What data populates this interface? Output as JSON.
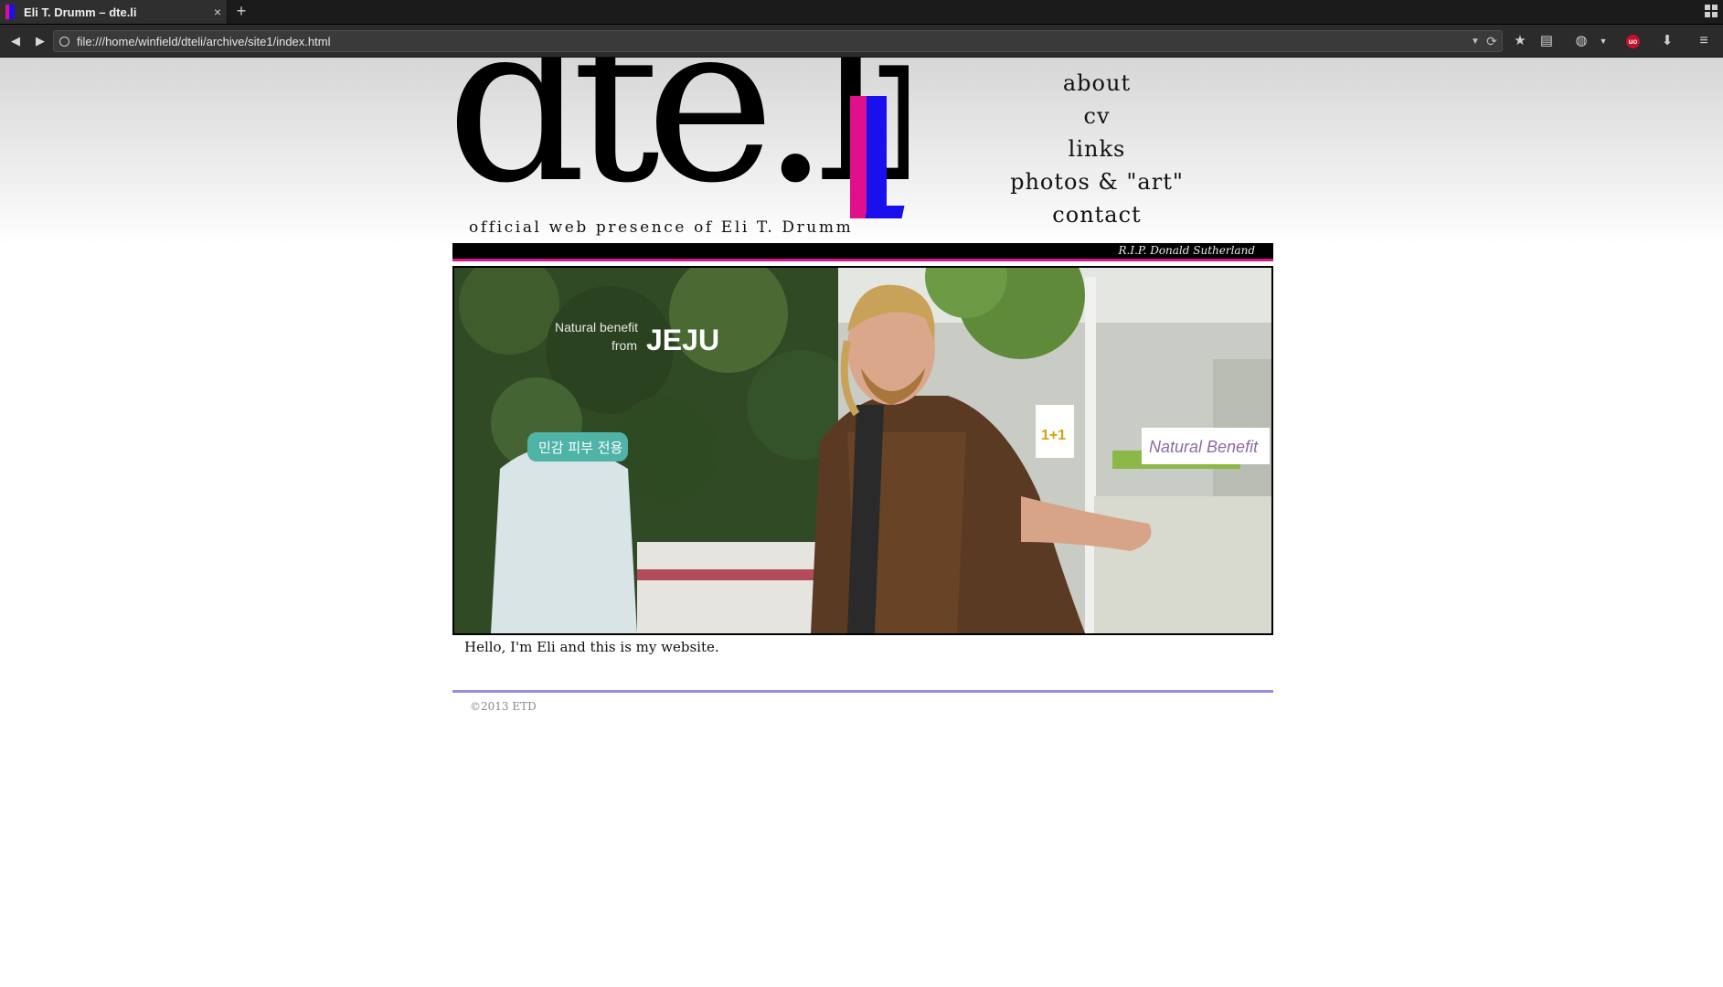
{
  "browser": {
    "tab_title": "Eli T. Drumm – dte.li",
    "tab_close": "×",
    "new_tab": "+",
    "url": "file:///home/winfield/dteli/archive/site1/index.html",
    "ublock_badge": "uo"
  },
  "header": {
    "logo_text": "dte.li",
    "tagline": "official web presence of Eli T. Drumm"
  },
  "nav": {
    "items": [
      {
        "label": "about"
      },
      {
        "label": "cv"
      },
      {
        "label": "links"
      },
      {
        "label": "photos & \"art\""
      },
      {
        "label": "contact"
      }
    ]
  },
  "banner": {
    "text": "R.I.P. Donald Sutherland"
  },
  "photo": {
    "sign_jeju_line1": "Natural benefit",
    "sign_jeju_line2": "from",
    "sign_jeju_brand": "JEJU",
    "sign_natural": "Natural Benefit",
    "sign_korean": "민감 피부 전용",
    "sign_promo": "1+1"
  },
  "main": {
    "intro": "Hello, I'm Eli and this is my website."
  },
  "footer": {
    "copyright": "©2013 ETD"
  },
  "colors": {
    "magenta": "#e0108c",
    "blue": "#1a10ee",
    "rule": "#9b8be4"
  }
}
